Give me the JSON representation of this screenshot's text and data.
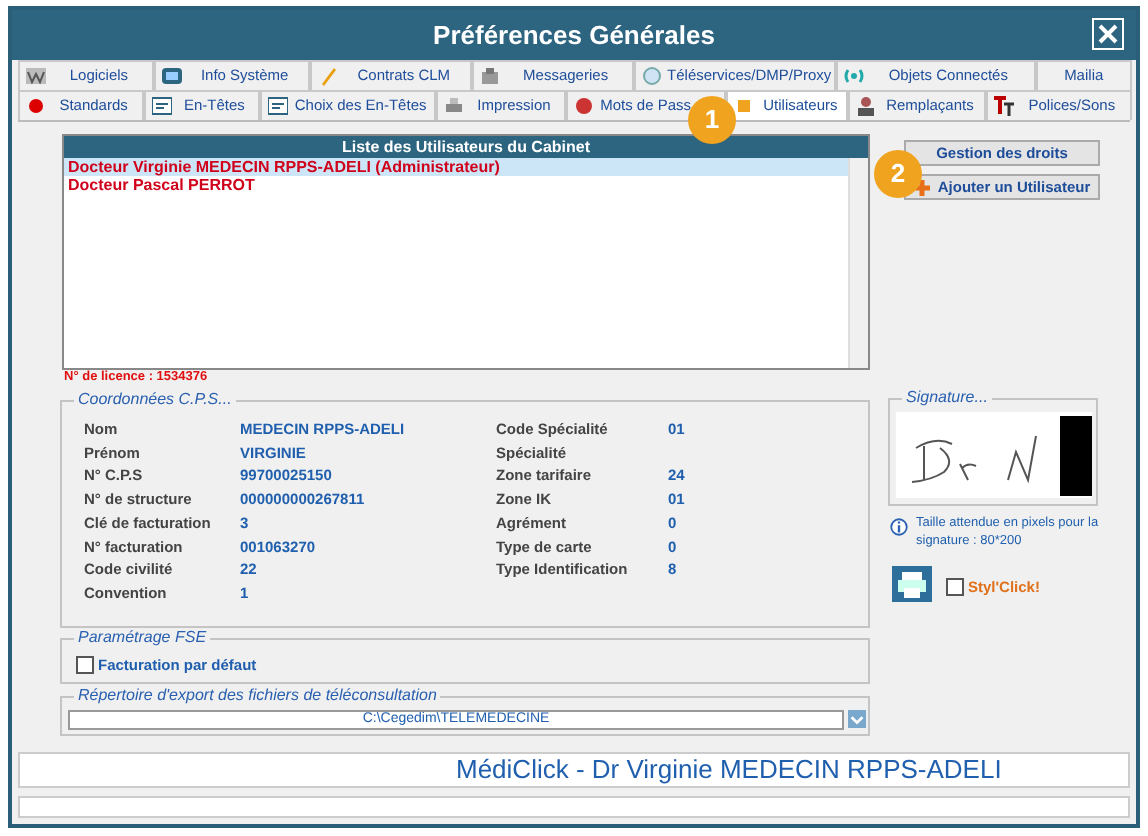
{
  "window": {
    "title": "Préférences Générales"
  },
  "tabs_row_1": [
    {
      "label": "Logiciels",
      "selected": false
    },
    {
      "label": "Info Système",
      "selected": false
    },
    {
      "label": "Contrats CLM",
      "selected": false
    },
    {
      "label": "Messageries",
      "selected": false
    },
    {
      "label": "Téléservices/DMP/Proxy",
      "selected": false
    },
    {
      "label": "Objets Connectés",
      "selected": false
    },
    {
      "label": "Mailia",
      "selected": false
    }
  ],
  "tabs_row_2": [
    {
      "label": "Standards",
      "selected": false
    },
    {
      "label": "En-Têtes",
      "selected": false
    },
    {
      "label": "Choix des En-Têtes",
      "selected": false
    },
    {
      "label": "Impression",
      "selected": false
    },
    {
      "label": "Mots de Pass",
      "selected": false
    },
    {
      "label": "Utilisateurs",
      "selected": true
    },
    {
      "label": "Remplaçants",
      "selected": false
    },
    {
      "label": "Polices/Sons",
      "selected": false
    }
  ],
  "callouts": [
    "1",
    "2"
  ],
  "users_list": {
    "title": "Liste des Utilisateurs du Cabinet",
    "items": [
      {
        "name": "Docteur Virginie MEDECIN RPPS-ADELI (Administrateur)",
        "selected": true
      },
      {
        "name": "Docteur Pascal PERROT",
        "selected": false
      }
    ]
  },
  "buttons": [
    "Gestion des droits",
    "Ajouter un Utilisateur"
  ],
  "licence": "N° de licence : 1534376",
  "cps": {
    "legend": "Coordonnées C.P.S...",
    "left": [
      {
        "label": "Nom",
        "value": "MEDECIN RPPS-ADELI"
      },
      {
        "label": "Prénom",
        "value": "VIRGINIE"
      },
      {
        "label": "N° C.P.S",
        "value": "99700025150"
      },
      {
        "label": "N° de structure",
        "value": "000000000267811"
      },
      {
        "label": "Clé de facturation",
        "value": "3"
      },
      {
        "label": "N° facturation",
        "value": "001063270"
      },
      {
        "label": "Code civilité",
        "value": "22"
      },
      {
        "label": "Convention",
        "value": "1"
      }
    ],
    "right": [
      {
        "label": "Code Spécialité",
        "value": "01"
      },
      {
        "label": "Spécialité"
      },
      {
        "label": "Zone tarifaire",
        "value": "24"
      },
      {
        "label": "Zone IK",
        "value": "01"
      },
      {
        "label": "Agrément",
        "value": "0"
      },
      {
        "label": "Type de carte",
        "value": "0"
      },
      {
        "label": "Type Identification",
        "value": "8"
      }
    ]
  },
  "signature": {
    "legend": "Signature...",
    "hint": "Taille attendue en pixels pour la signature : 80*200"
  },
  "stylclick": {
    "label": "Styl'Click!",
    "checked": false
  },
  "fse": {
    "legend": "Paramétrage FSE",
    "default_billing": {
      "label": "Facturation par défaut",
      "checked": false
    }
  },
  "export_dir": {
    "legend": "Répertoire d'export des fichiers de téléconsultation",
    "value": "C:\\Cegedim\\TELEMEDECINE"
  },
  "status": "MédiClick - Dr Virginie MEDECIN RPPS-ADELI"
}
